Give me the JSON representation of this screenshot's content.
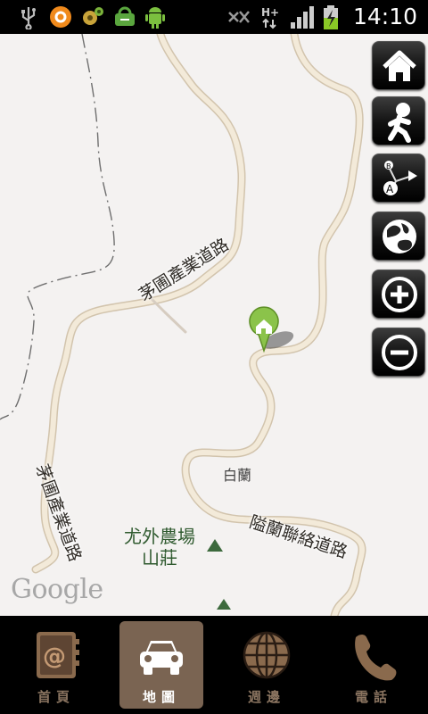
{
  "status_bar": {
    "clock": "14:10",
    "icons": [
      "usb-icon",
      "app-circle-icon",
      "gear-app-icon",
      "sync-icon",
      "android-icon",
      "mute-icon",
      "hplus-signal-icon",
      "signal-bars-icon",
      "battery-charging-icon"
    ]
  },
  "map": {
    "labels": {
      "poi_farm_line1": "尤外農場",
      "poi_farm_line2": "山莊",
      "place_bailan": "白蘭",
      "road_maoyuan_1": "茅圃產業道路",
      "road_maoyuan_2": "茅圃產業道路",
      "road_bailan": "隘蘭聯絡道路"
    },
    "attribution": "Google",
    "colors": {
      "road": "#e6dccb",
      "road_edge": "#cdbfa7",
      "background": "#f4f2f1",
      "marker": "#8bc34a"
    }
  },
  "map_controls": [
    "home-icon",
    "walking-person-icon",
    "route-a-b-icon",
    "globe-icon",
    "zoom-in-icon",
    "zoom-out-icon"
  ],
  "bottom_nav": {
    "items": [
      {
        "label": "首頁",
        "icon": "address-book-icon",
        "active": false
      },
      {
        "label": "地圖",
        "icon": "car-icon",
        "active": true
      },
      {
        "label": "週邊",
        "icon": "globe-grid-icon",
        "active": false
      },
      {
        "label": "電話",
        "icon": "phone-icon",
        "active": false
      }
    ]
  }
}
